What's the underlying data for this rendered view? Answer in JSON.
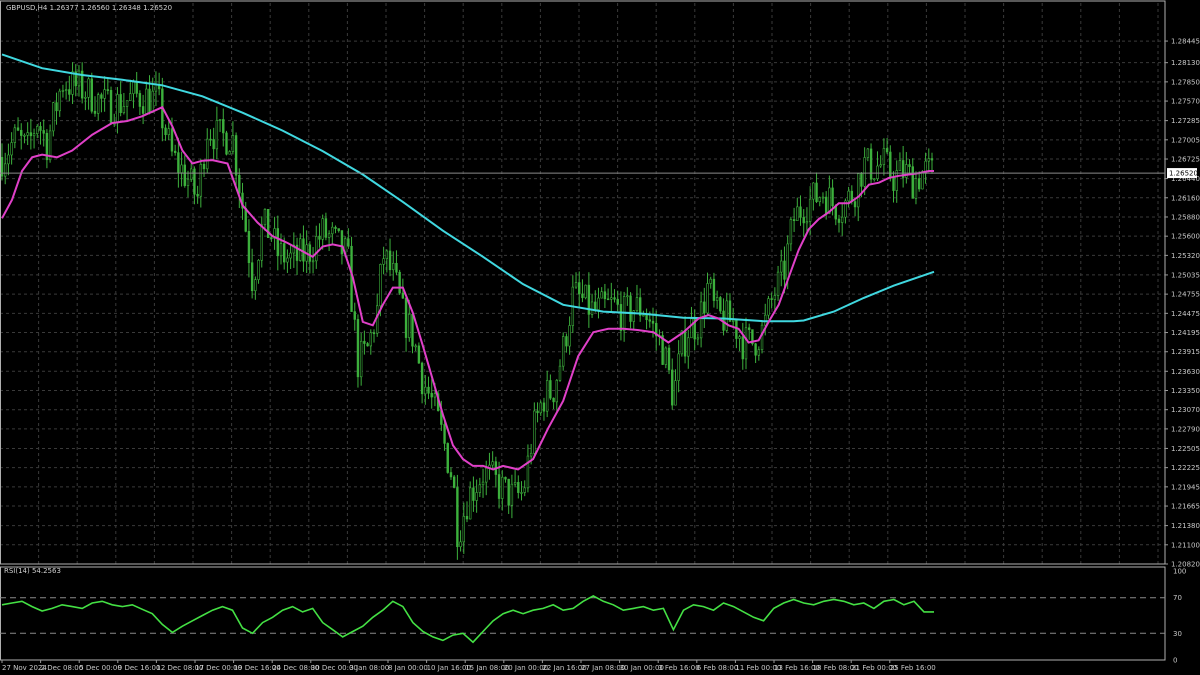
{
  "header": {
    "instrument": "GBPUSD,H4  1.26377 1.26560 1.26348 1.26520",
    "indicator": "RSI(14) 54.2563"
  },
  "colors": {
    "background": "#000000",
    "grid": "#3a3a3a",
    "candle": "#3db13d",
    "ma_fast": "#e040c8",
    "ma_slow": "#40d8e0",
    "rsi": "#44e044",
    "current_price_box": "#ffffff"
  },
  "chart_data": [
    {
      "type": "candlestick",
      "symbol": "GBPUSD",
      "timeframe": "H4",
      "current_price": "1.26520",
      "ylim": [
        1.2082,
        1.29
      ],
      "y_ticks": [
        "1.28445",
        "1.28130",
        "1.27850",
        "1.27570",
        "1.27285",
        "1.27005",
        "1.26725",
        "1.26440",
        "1.26160",
        "1.25880",
        "1.25600",
        "1.25320",
        "1.25035",
        "1.24755",
        "1.24475",
        "1.24195",
        "1.23915",
        "1.23630",
        "1.23350",
        "1.23070",
        "1.22790",
        "1.22505",
        "1.22225",
        "1.21945",
        "1.21665",
        "1.21380",
        "1.21100",
        "1.20820"
      ],
      "x_ticks": [
        "27 Nov 2024",
        "2 Dec 08:00",
        "5 Dec 00:00",
        "9 Dec 16:00",
        "12 Dec 08:00",
        "17 Dec 00:00",
        "19 Dec 16:00",
        "24 Dec 08:00",
        "30 Dec 00:00",
        "3 Jan 08:00",
        "8 Jan 00:00",
        "10 Jan 16:00",
        "15 Jan 08:00",
        "20 Jan 00:00",
        "22 Jan 16:00",
        "27 Jan 08:00",
        "30 Jan 00:00",
        "3 Feb 16:00",
        "6 Feb 08:00",
        "11 Feb 00:00",
        "13 Feb 16:00",
        "18 Feb 08:00",
        "21 Feb 00:00",
        "25 Feb 16:00"
      ],
      "close_path_index": [
        0,
        15,
        25,
        35,
        45,
        60,
        80,
        105,
        120,
        135,
        155,
        170,
        185,
        195,
        205,
        215,
        230,
        243,
        250,
        260,
        268,
        275,
        290,
        305,
        320,
        330,
        345,
        355,
        365,
        375,
        380,
        392,
        400,
        410,
        420,
        430,
        440,
        450,
        455,
        465,
        480,
        490,
        500,
        510,
        520,
        530,
        540,
        550,
        560,
        570,
        580,
        590,
        600,
        610,
        620,
        630,
        640,
        650,
        660,
        670,
        678,
        685,
        695,
        705,
        712,
        720,
        730,
        740,
        750,
        760,
        770,
        780,
        790,
        800,
        810,
        820,
        830,
        840,
        850,
        860,
        870,
        880,
        890,
        900,
        910,
        920,
        930
      ],
      "close_path": [
        1.2675,
        1.2705,
        1.2685,
        1.273,
        1.2695,
        1.2785,
        1.2775,
        1.275,
        1.2755,
        1.2765,
        1.276,
        1.2675,
        1.2645,
        1.2615,
        1.272,
        1.2705,
        1.2705,
        1.2575,
        1.2495,
        1.2575,
        1.2565,
        1.2535,
        1.2525,
        1.2535,
        1.2565,
        1.2555,
        1.253,
        1.2375,
        1.2395,
        1.2455,
        1.2535,
        1.2495,
        1.2445,
        1.2415,
        1.235,
        1.2315,
        1.2265,
        1.2205,
        1.2125,
        1.218,
        1.2215,
        1.2205,
        1.219,
        1.218,
        1.2185,
        1.2275,
        1.2325,
        1.2335,
        1.2395,
        1.2475,
        1.2465,
        1.245,
        1.2455,
        1.246,
        1.2445,
        1.2455,
        1.2455,
        1.2425,
        1.2395,
        1.2325,
        1.2395,
        1.2425,
        1.2435,
        1.249,
        1.2445,
        1.244,
        1.2435,
        1.2405,
        1.2405,
        1.2425,
        1.2475,
        1.2505,
        1.2585,
        1.2605,
        1.2615,
        1.2625,
        1.2605,
        1.2605,
        1.2625,
        1.2665,
        1.266,
        1.2665,
        1.2645,
        1.2655,
        1.264,
        1.2655,
        1.2652
      ],
      "ma_fast": {
        "index": [
          0,
          10,
          20,
          30,
          40,
          55,
          70,
          90,
          110,
          125,
          140,
          160,
          170,
          180,
          190,
          200,
          210,
          225,
          240,
          255,
          270,
          285,
          300,
          310,
          320,
          330,
          340,
          350,
          360,
          370,
          380,
          390,
          400,
          410,
          420,
          430,
          440,
          450,
          460,
          470,
          480,
          490,
          500,
          515,
          530,
          545,
          560,
          575,
          590,
          605,
          620,
          635,
          650,
          665,
          680,
          695,
          705,
          715,
          725,
          735,
          745,
          755,
          765,
          775,
          785,
          795,
          805,
          815,
          825,
          835,
          845,
          855,
          865,
          875,
          885,
          895,
          905,
          915,
          925,
          930
        ],
        "value": [
          1.2586,
          1.2613,
          1.2655,
          1.2675,
          1.2679,
          1.2675,
          1.2685,
          1.2708,
          1.2725,
          1.2728,
          1.2735,
          1.2748,
          1.272,
          1.2685,
          1.2666,
          1.267,
          1.2671,
          1.2666,
          1.2605,
          1.258,
          1.256,
          1.255,
          1.2538,
          1.253,
          1.2545,
          1.2548,
          1.2545,
          1.25,
          1.2435,
          1.243,
          1.246,
          1.2485,
          1.2485,
          1.2448,
          1.24,
          1.235,
          1.23,
          1.2255,
          1.2235,
          1.2225,
          1.2225,
          1.222,
          1.2225,
          1.222,
          1.2235,
          1.228,
          1.232,
          1.2385,
          1.242,
          1.2425,
          1.2425,
          1.2423,
          1.242,
          1.2405,
          1.242,
          1.244,
          1.2445,
          1.244,
          1.243,
          1.2425,
          1.2405,
          1.2408,
          1.2435,
          1.246,
          1.25,
          1.254,
          1.257,
          1.2585,
          1.2595,
          1.2608,
          1.2608,
          1.2618,
          1.2635,
          1.2638,
          1.2645,
          1.2648,
          1.265,
          1.2652,
          1.2655,
          1.2655
        ]
      },
      "ma_slow": {
        "index": [
          0,
          40,
          80,
          120,
          160,
          200,
          240,
          280,
          320,
          360,
          400,
          440,
          480,
          520,
          560,
          600,
          640,
          680,
          720,
          760,
          790,
          800,
          830,
          860,
          890,
          930
        ],
        "value": [
          1.2825,
          1.2805,
          1.2795,
          1.2788,
          1.278,
          1.2764,
          1.274,
          1.2714,
          1.2684,
          1.265,
          1.261,
          1.2568,
          1.253,
          1.249,
          1.246,
          1.245,
          1.2447,
          1.2441,
          1.244,
          1.2436,
          1.2436,
          1.2437,
          1.245,
          1.247,
          1.2488,
          1.2508
        ]
      }
    },
    {
      "type": "line",
      "name": "RSI(14)",
      "ylim": [
        0,
        100
      ],
      "y_ticks": [
        "100",
        "70",
        "30",
        "0"
      ],
      "levels": [
        70,
        30
      ],
      "index": [
        0,
        10,
        20,
        30,
        40,
        50,
        60,
        70,
        80,
        90,
        100,
        110,
        120,
        130,
        140,
        150,
        160,
        170,
        180,
        190,
        200,
        210,
        220,
        230,
        240,
        250,
        260,
        270,
        280,
        290,
        300,
        310,
        320,
        330,
        340,
        350,
        360,
        370,
        380,
        390,
        400,
        410,
        420,
        430,
        440,
        450,
        460,
        470,
        480,
        490,
        500,
        510,
        520,
        530,
        540,
        550,
        560,
        570,
        580,
        590,
        600,
        610,
        620,
        630,
        640,
        650,
        660,
        670,
        680,
        690,
        700,
        710,
        720,
        730,
        740,
        750,
        760,
        770,
        780,
        790,
        800,
        810,
        820,
        830,
        840,
        850,
        860,
        870,
        880,
        890,
        900,
        910,
        920,
        930
      ],
      "value": [
        62,
        64,
        66,
        60,
        55,
        58,
        62,
        60,
        58,
        64,
        66,
        62,
        60,
        62,
        57,
        52,
        40,
        31,
        38,
        44,
        50,
        56,
        60,
        56,
        36,
        30,
        42,
        48,
        56,
        60,
        54,
        58,
        42,
        34,
        26,
        32,
        38,
        48,
        56,
        66,
        60,
        42,
        32,
        26,
        22,
        28,
        30,
        20,
        32,
        44,
        52,
        56,
        52,
        56,
        58,
        62,
        56,
        58,
        66,
        72,
        66,
        62,
        56,
        58,
        60,
        56,
        58,
        34,
        56,
        62,
        60,
        56,
        64,
        60,
        54,
        48,
        44,
        58,
        64,
        68,
        64,
        62,
        66,
        68,
        66,
        62,
        64,
        58,
        66,
        68,
        62,
        66,
        54,
        54
      ]
    }
  ]
}
